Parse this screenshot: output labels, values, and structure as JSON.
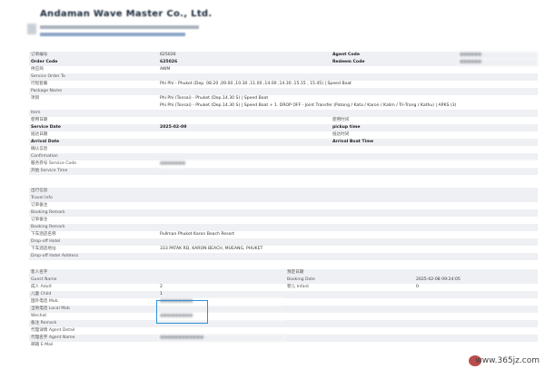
{
  "header": {
    "company": "Andaman Wave Master Co., Ltd."
  },
  "order": {
    "order_code_cn": "订单编号",
    "order_code_en": "Order Code",
    "order_code_value": "625026",
    "agent_code_cn": "Agent Code",
    "redeem_code": "Redeem Code",
    "service_order_to_cn": "供应商",
    "service_order_to_en": "Service Order To",
    "service_order_to_value": "AWM",
    "package_name_cn": "行程套餐",
    "package_name_en": "Package Name",
    "package_name_value": "Phi Phi - Phuket (Dep. 08.20 ,09.00 ,10.30 ,11.00 ,14.00 ,14.30 ,15.15 , 15.45) | Speed Boat",
    "item_cn": "项目",
    "item_en": "Item",
    "item_line1": "Phi Phi (Tonsai) - Phuket (Dep.14.30 S) | Speed Boat",
    "item_line2": "Phi Phi (Tonsai) - Phuket (Dep.14.30 S) | Speed Boat + 1. DROP OFF - Joint Transfer (Patong / Kata / Karon / Kalim / Tri-Trang / Kathu) | APKS (3)",
    "service_date_cn": "使用日期",
    "service_date_en": "Service Date",
    "service_date_value": "2025-02-09",
    "pickup_time_cn": "使用时间",
    "pickup_time_en": "pickup time",
    "arrival_date_cn": "抵达日期",
    "arrival_date_en": "Arrival Date",
    "arrival_boat_time_cn": "抵达时间",
    "arrival_boat_time_en": "Arrival Boat Time",
    "confirmation_cn": "确认信息",
    "confirmation_en": "Confirmation",
    "service_code_cn": "服务券号 Service Code",
    "service_time_cn": "开始 Service Time"
  },
  "travel": {
    "travel_info_cn": "出行信息",
    "travel_info_en": "Travel Info",
    "booking_remark_cn_1": "订单备注",
    "booking_remark_en_1": "Booking Remark",
    "booking_remark_cn_2": "订单备注",
    "booking_remark_en_2": "Booking Remark",
    "dropoff_hotel_cn": "下车酒店名称",
    "dropoff_hotel_en": "Drop-off Hotel",
    "dropoff_hotel_value": "Pullman Phuket Karon Beach Resort",
    "dropoff_addr_cn": "下车酒店地址",
    "dropoff_addr_en": "Drop-off Hotel Address",
    "dropoff_addr_value": "333 PATAK RD, KARON BEACH, MUEANG, PHUKET"
  },
  "guest": {
    "guest_name_cn": "客人名字",
    "guest_name_en": "Guest Name",
    "booking_date_cn": "预定日期",
    "booking_date_en": "Booking Date",
    "booking_date_value": "2025-02-08 09:24:05",
    "adult_label": "成人 Adult",
    "adult_value": "2",
    "infant_label": "婴儿 Infant",
    "infant_value": "0",
    "child_label": "儿童 Child",
    "child_value": "1",
    "mob_label": "国外电话 Mob.",
    "local_mob_label": "当地电话 Local Mob",
    "wechat_label": "Wechat",
    "remark_label": "备注 Remark",
    "agent_detail_label": "代理详情 Agent Detail",
    "agent_name_label": "代理名字 Agent Name",
    "email_label": "邮箱 E-Mail"
  },
  "watermark": "www.365jz.com"
}
